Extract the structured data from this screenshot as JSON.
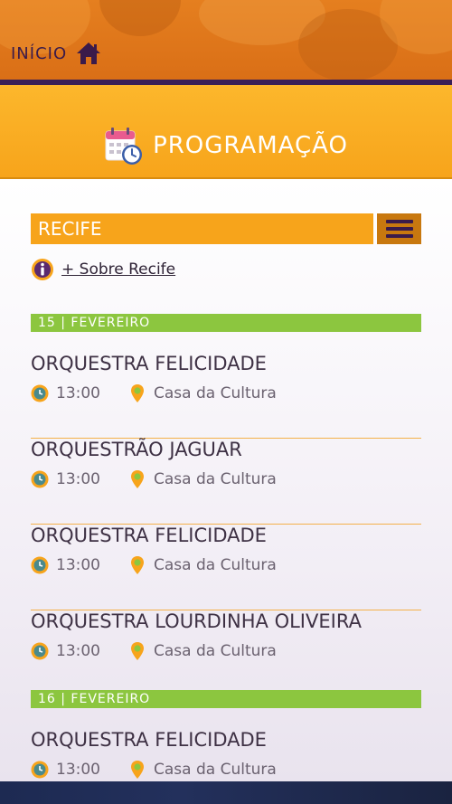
{
  "header": {
    "home_label": "INÍCIO",
    "home_icon": "home-icon"
  },
  "section": {
    "title": "PROGRAMAÇÃO",
    "icon": "calendar-clock-icon"
  },
  "city": {
    "selected": "RECIFE",
    "menu_icon": "hamburger-icon"
  },
  "about": {
    "label": "+ Sobre Recife",
    "icon": "info-icon"
  },
  "colors": {
    "orange": "#f7a41b",
    "green": "#8cc63f",
    "purple": "#3b1b4a"
  },
  "days": [
    {
      "date": "15  |  FEVEREIRO",
      "events": [
        {
          "title": "ORQUESTRA FELICIDADE",
          "time": "13:00",
          "place": "Casa da Cultura"
        },
        {
          "title": "ORQUESTRÃO JAGUAR",
          "time": "13:00",
          "place": "Casa da Cultura"
        },
        {
          "title": "ORQUESTRA FELICIDADE",
          "time": "13:00",
          "place": "Casa da Cultura"
        },
        {
          "title": "ORQUESTRA LOURDINHA OLIVEIRA",
          "time": "13:00",
          "place": "Casa da Cultura"
        }
      ]
    },
    {
      "date": "16  |  FEVEREIRO",
      "events": [
        {
          "title": "ORQUESTRA FELICIDADE",
          "time": "13:00",
          "place": "Casa da Cultura"
        }
      ]
    }
  ]
}
